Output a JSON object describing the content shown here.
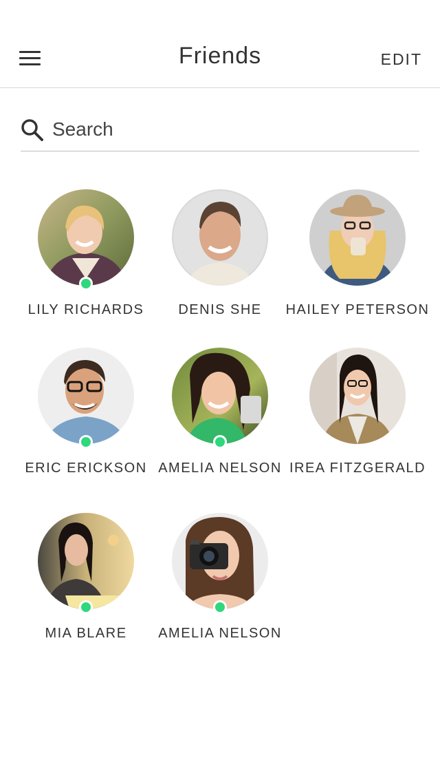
{
  "header": {
    "title": "Friends",
    "edit_label": "EDIT",
    "menu_icon": "hamburger-menu-icon"
  },
  "search": {
    "placeholder": "Search",
    "value": "",
    "icon": "search-icon"
  },
  "colors": {
    "online": "#2fd77d",
    "text": "#333333",
    "divider": "#d6d6d6"
  },
  "friends": [
    {
      "name": "LILY RICHARDS",
      "online": true
    },
    {
      "name": "DENIS SHE",
      "online": false
    },
    {
      "name": "HAILEY PETERSON",
      "online": false
    },
    {
      "name": "ERIC ERICKSON",
      "online": true
    },
    {
      "name": "AMELIA NELSON",
      "online": true
    },
    {
      "name": "IREA FITZGERALD",
      "online": false
    },
    {
      "name": "MIA BLARE",
      "online": true
    },
    {
      "name": "AMELIA NELSON",
      "online": true
    }
  ]
}
